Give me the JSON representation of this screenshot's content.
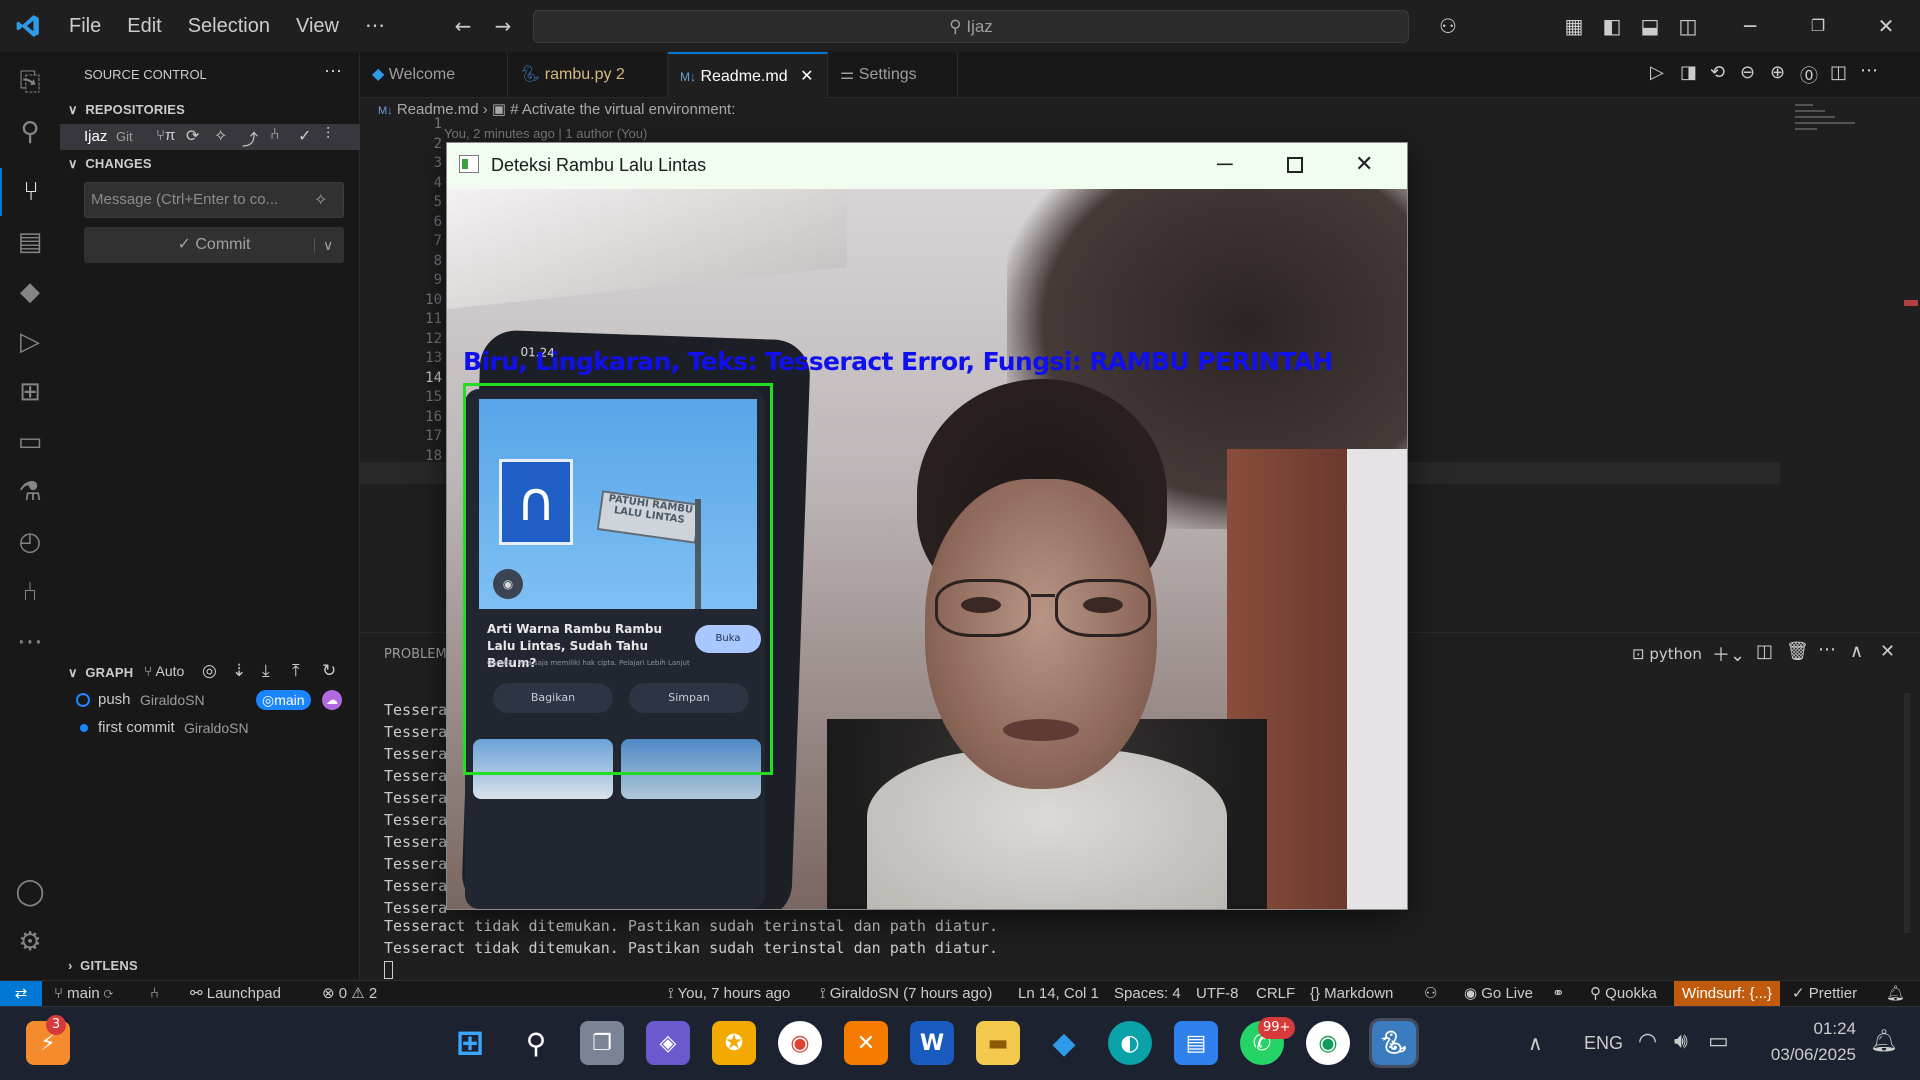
{
  "titlebar": {
    "menus": [
      "File",
      "Edit",
      "Selection",
      "View",
      "⋯"
    ],
    "search_text": "⚲ Ijaz"
  },
  "sidebar": {
    "title": "SOURCE CONTROL",
    "repositories_label": "REPOSITORIES",
    "repo_name": "Ijaz",
    "repo_type": "Git",
    "repo_branch_short": "π",
    "changes_label": "CHANGES",
    "message_placeholder": "Message (Ctrl+Enter to co...",
    "commit_label": "✓ Commit",
    "graph_label": "GRAPH",
    "graph_auto": "Auto",
    "commits": [
      {
        "message": "push",
        "author": "GiraldoSN",
        "branch": "main"
      },
      {
        "message": "first commit",
        "author": "GiraldoSN"
      }
    ],
    "gitlens_label": "GITLENS"
  },
  "tabs": [
    {
      "label": "Welcome"
    },
    {
      "label": "rambu.py 2"
    },
    {
      "label": "Readme.md"
    },
    {
      "label": "Settings"
    }
  ],
  "editor": {
    "breadcrumb_file": "Readme.md",
    "breadcrumb_sep": "›",
    "breadcrumb_item": "# Activate the virtual environment:",
    "blame": "You, 2 minutes ago | 1 author (You)",
    "line_numbers": [
      "1",
      "2",
      "3",
      "4",
      "5",
      "6",
      "7",
      "8",
      "9",
      "10",
      "11",
      "12",
      "13",
      "14",
      "15",
      "16",
      "17",
      "18"
    ]
  },
  "panel": {
    "tab_problems": "PROBLEMS",
    "terminal_name": "python",
    "partial_line": "Tessera",
    "terminal_lines": [
      "Tesseract tidak ditemukan. Pastikan sudah terinstal dan path diatur.",
      "Tesseract tidak ditemukan. Pastikan sudah terinstal dan path diatur."
    ]
  },
  "popup": {
    "title": "Deteksi Rambu Lalu Lintas",
    "overlay_text": "Biru, Lingkaran, Teks: Tesseract Error, Fungsi: RAMBU PERINTAH",
    "sign_text": "PATUHI RAMBU LALU LINTAS",
    "card_title": "Arti Warna Rambu Rambu Lalu Lintas, Sudah Tahu Belum?",
    "card_sub": "Gambar bisa saja memiliki hak cipta. Pelajari Lebih Lanjut",
    "card_btn": "Buka",
    "share_btn": "Bagikan",
    "save_btn": "Simpan",
    "phone_time": "01.24"
  },
  "statusbar": {
    "branch": "main",
    "launchpad": "Launchpad",
    "errors": "⊗ 0 ⚠ 2",
    "blame": "You, 7 hours ago",
    "author": "GiraldoSN (7 hours ago)",
    "position": "Ln 14, Col 1",
    "spaces": "Spaces: 4",
    "encoding": "UTF-8",
    "eol": "CRLF",
    "language": "{} Markdown",
    "golive": "Go Live",
    "quokka": "Quokka",
    "windsurf": "Windsurf: {...}",
    "prettier": "Prettier"
  },
  "taskbar": {
    "badge_left": "3",
    "whatsapp_badge": "99+",
    "lang": "ENG",
    "time": "01:24",
    "date": "03/06/2025"
  },
  "colors": {
    "accent": "#0078d4",
    "detect_box": "#22dd22",
    "overlay_text": "#1010ee",
    "windsurf_bg": "#c05a0c"
  }
}
